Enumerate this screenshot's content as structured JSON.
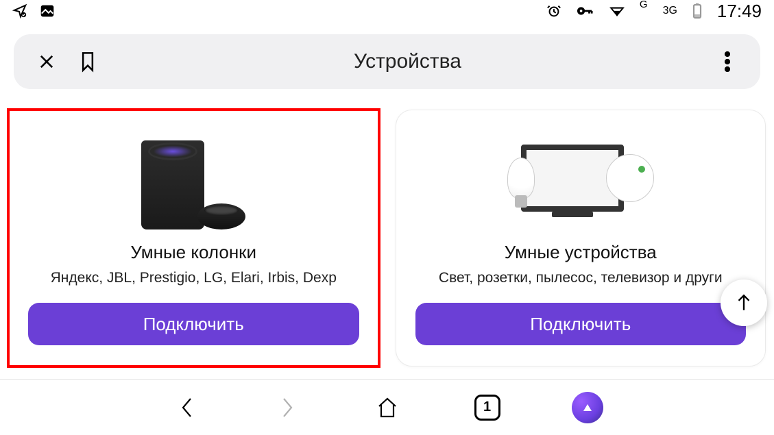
{
  "status": {
    "network1": "G",
    "network2": "3G",
    "time": "17:49"
  },
  "header": {
    "title": "Устройства"
  },
  "cards": [
    {
      "title": "Умные колонки",
      "subtitle": "Яндекс, JBL, Prestigio, LG, Elari, Irbis, Dexp",
      "button": "Подключить"
    },
    {
      "title": "Умные устройства",
      "subtitle": "Свет, розетки, пылесос, телевизор и други",
      "button": "Подключить"
    }
  ],
  "nav": {
    "tabs_count": "1"
  }
}
